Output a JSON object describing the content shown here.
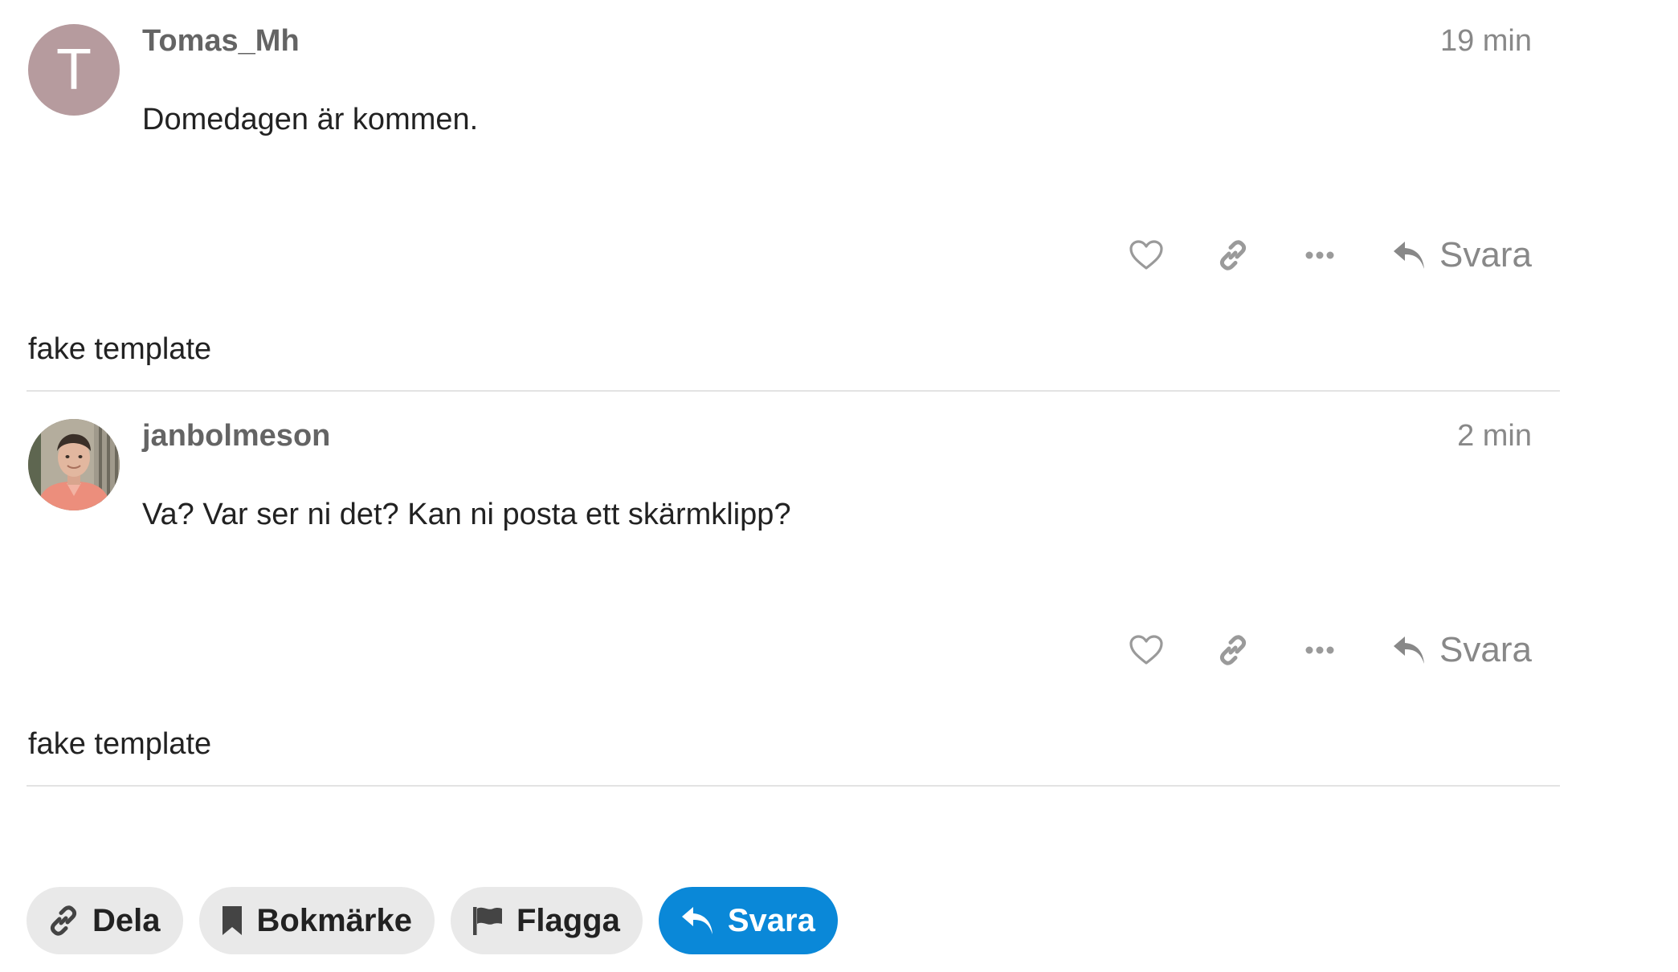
{
  "posts": [
    {
      "username": "Tomas_Mh",
      "avatar_letter": "T",
      "date": "19 min",
      "body": "Domedagen är kommen.",
      "reply_label": "Svara",
      "note": "fake template"
    },
    {
      "username": "janbolmeson",
      "date": "2 min",
      "body": "Va? Var ser ni det? Kan ni posta ett skärmklipp?",
      "reply_label": "Svara",
      "note": "fake template"
    }
  ],
  "footer": {
    "share_label": "Dela",
    "bookmark_label": "Bokmärke",
    "flag_label": "Flagga",
    "reply_label": "Svara"
  },
  "colors": {
    "avatar_bg": "#b69b9e",
    "primary": "#0a88d8",
    "muted": "#888888",
    "button_grey": "#e9e9e9"
  },
  "icons": {
    "like": "heart-icon",
    "copy_link": "link-icon",
    "more": "ellipsis-icon",
    "reply": "reply-icon",
    "bookmark": "bookmark-icon",
    "flag": "flag-icon"
  }
}
